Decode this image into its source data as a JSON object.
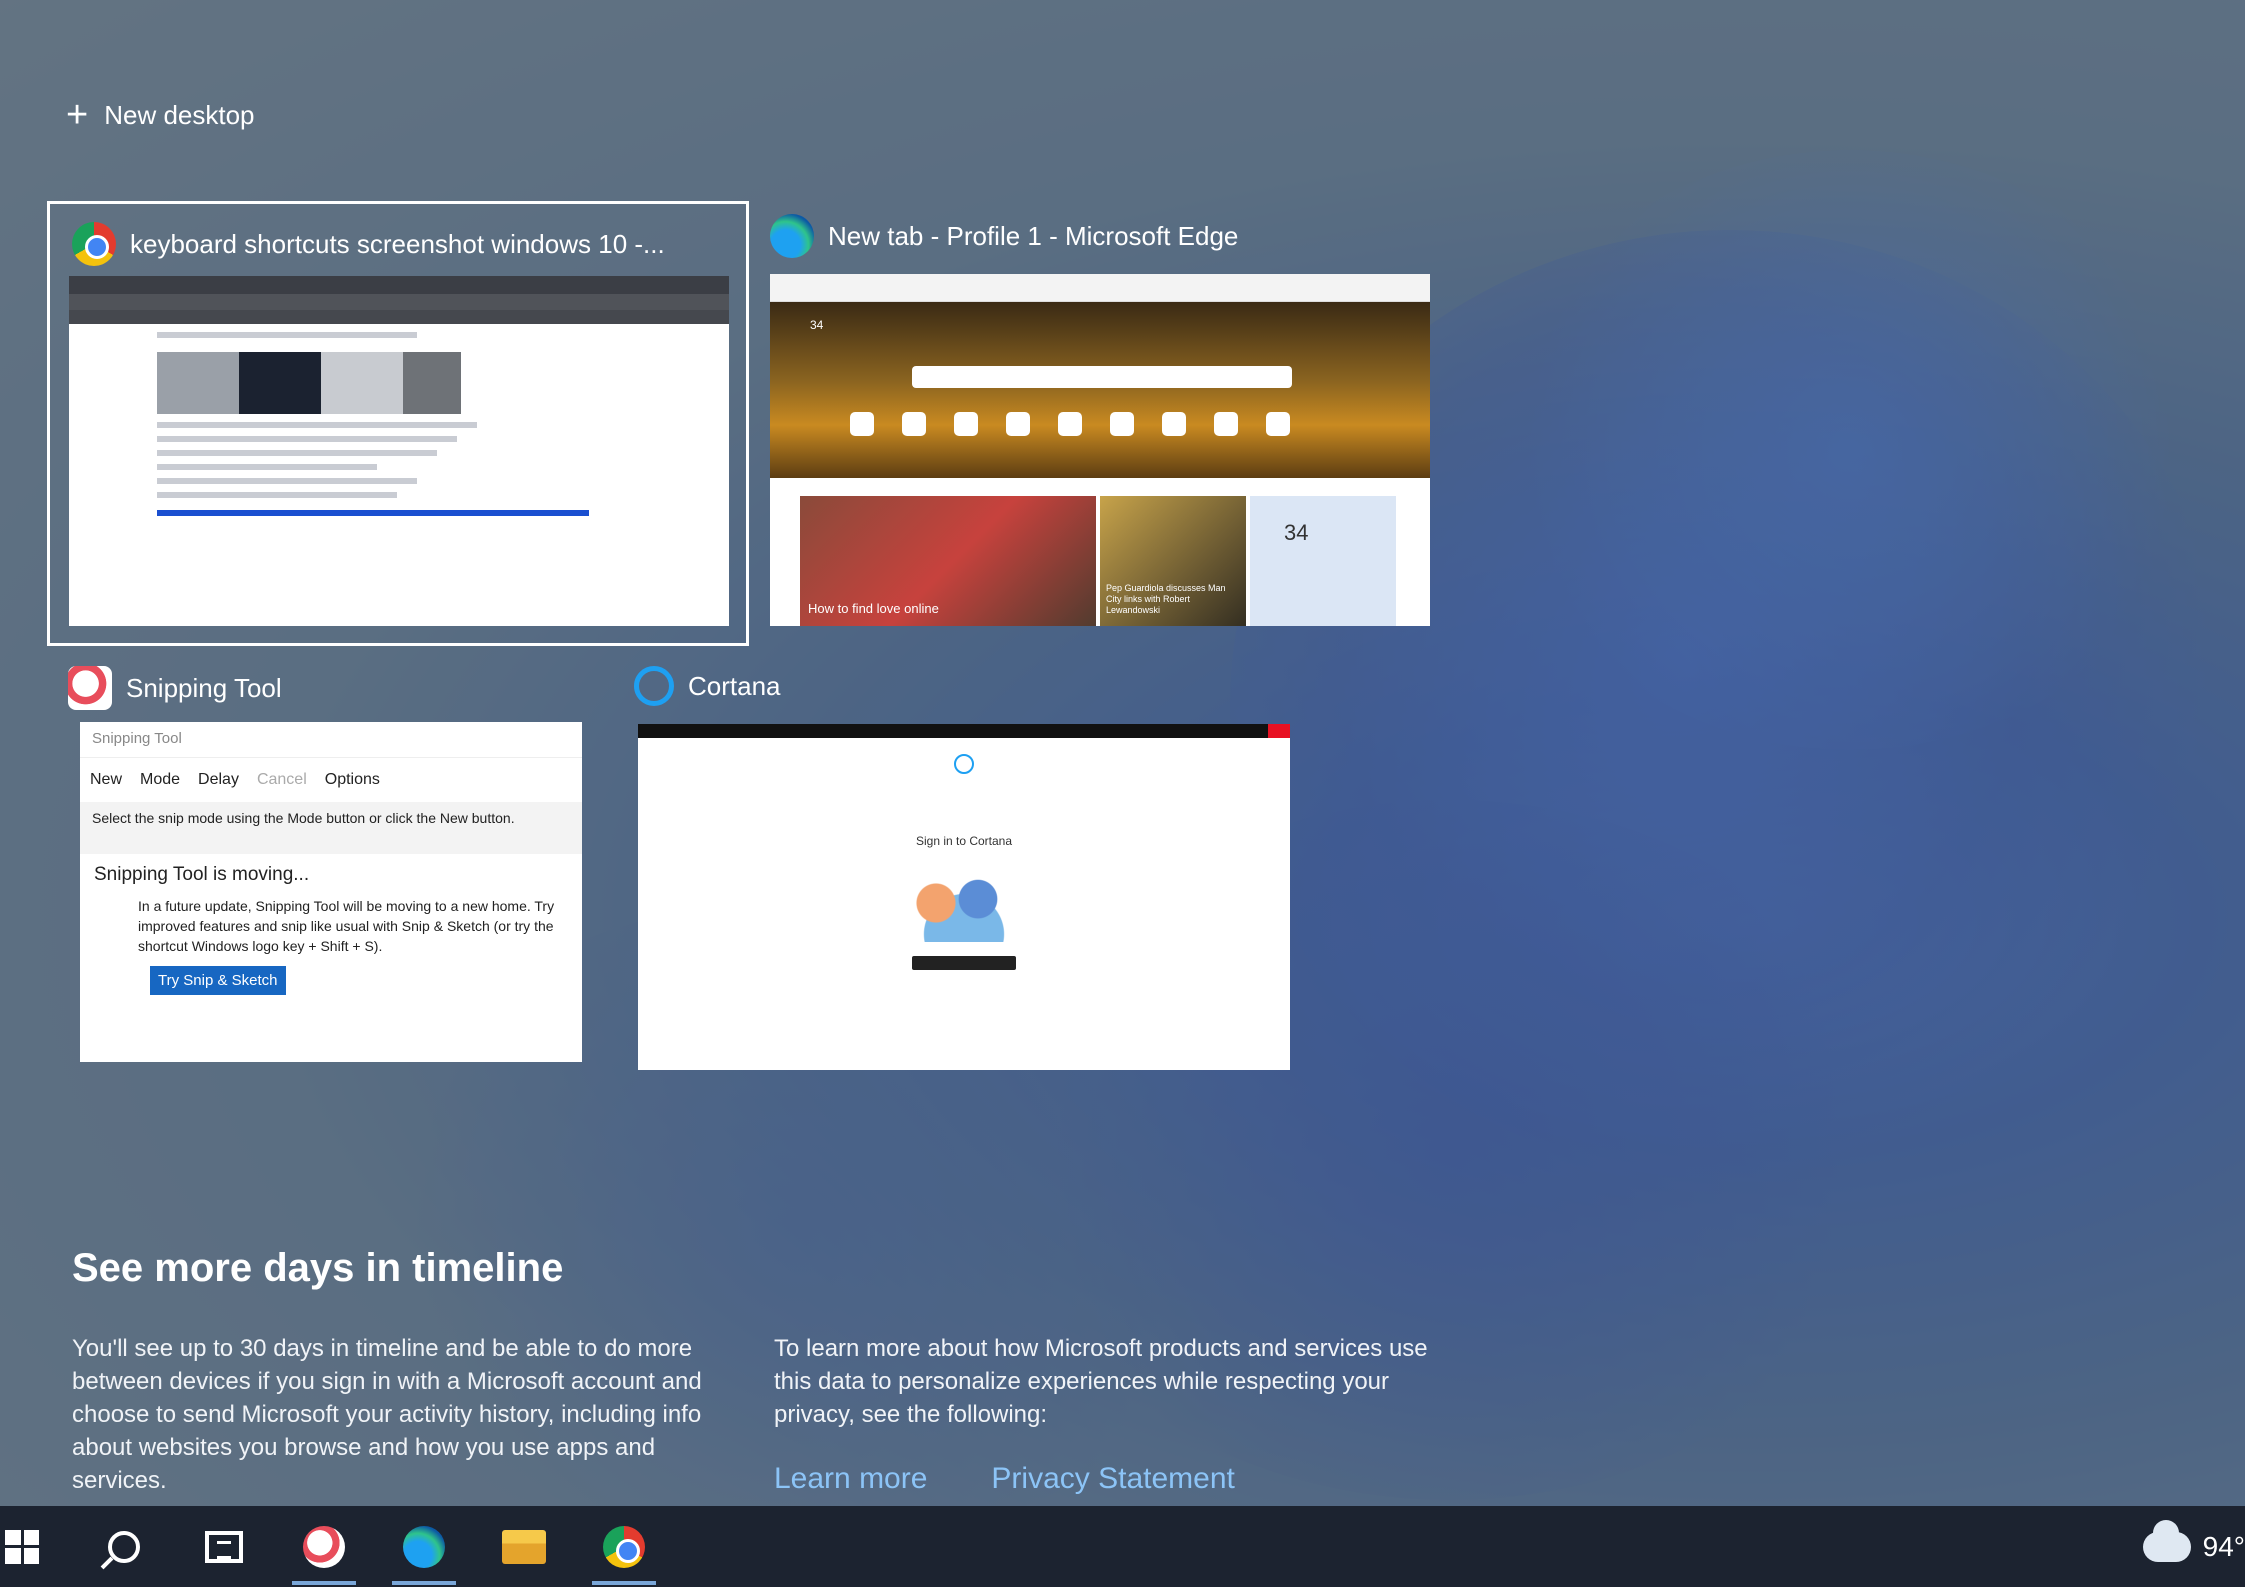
{
  "new_desktop": {
    "label": "New desktop"
  },
  "windows": [
    {
      "title": "keyboard shortcuts screenshot windows 10 -...",
      "app_icon": "chrome-icon",
      "selected": true
    },
    {
      "title": "New tab - Profile 1 - Microsoft Edge",
      "app_icon": "edge-icon"
    },
    {
      "title": "Snipping Tool",
      "app_icon": "snipping-tool-icon"
    },
    {
      "title": "Cortana",
      "app_icon": "cortana-icon"
    }
  ],
  "snipping_tool": {
    "window_title": "Snipping Tool",
    "new_label": "New",
    "mode_label": "Mode",
    "delay_label": "Delay",
    "cancel_label": "Cancel",
    "options_label": "Options",
    "hint": "Select the snip mode using the Mode button or click the New button.",
    "moving_title": "Snipping Tool is moving...",
    "moving_body": "In a future update, Snipping Tool will be moving to a new home. Try improved features and snip like usual with Snip & Sketch (or try the shortcut Windows logo key + Shift + S).",
    "try_button": "Try Snip & Sketch"
  },
  "edge_preview": {
    "temperature": "34",
    "news_headline": "How to find love online",
    "side_headline": "Pep Guardiola discusses Man City links with Robert Lewandowski"
  },
  "cortana": {
    "signin_text": "Sign in to Cortana"
  },
  "timeline": {
    "title": "See more days in timeline",
    "col1": "You'll see up to 30 days in timeline and be able to do more between devices if you sign in with a Microsoft account and choose to send Microsoft your activity history, including info about websites you browse and how you use apps and services.",
    "col2": "To learn more about how Microsoft products and services use this data to personalize experiences while respecting your privacy, see the following:",
    "learn_more": "Learn more",
    "privacy": "Privacy Statement"
  },
  "taskbar": {
    "items": [
      "start-icon",
      "search-icon",
      "task-view-icon",
      "snipping-tool-icon",
      "edge-icon",
      "file-explorer-icon",
      "chrome-icon"
    ],
    "temperature": "94°"
  },
  "colors": {
    "accent_link": "#8cc4f7",
    "taskbar": "#1c2330"
  }
}
